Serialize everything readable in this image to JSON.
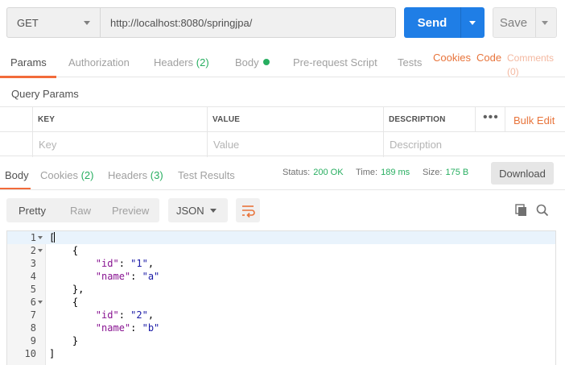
{
  "request": {
    "method": "GET",
    "url": "http://localhost:8080/springjpa/",
    "send_label": "Send",
    "save_label": "Save"
  },
  "request_tabs": [
    {
      "label": "Params"
    },
    {
      "label": "Authorization"
    },
    {
      "label": "Headers",
      "count": "(2)"
    },
    {
      "label": "Body"
    },
    {
      "label": "Pre-request Script"
    },
    {
      "label": "Tests"
    }
  ],
  "links": {
    "cookies": "Cookies",
    "code": "Code",
    "comments": "Comments",
    "comments_count": "(0)"
  },
  "query_params": {
    "title": "Query Params",
    "headers": [
      "KEY",
      "VALUE",
      "DESCRIPTION"
    ],
    "placeholders": [
      "Key",
      "Value",
      "Description"
    ],
    "more": "•••",
    "bulk_edit": "Bulk Edit"
  },
  "response_tabs": [
    {
      "label": "Body"
    },
    {
      "label": "Cookies",
      "count": "(2)"
    },
    {
      "label": "Headers",
      "count": "(3)"
    },
    {
      "label": "Test Results"
    }
  ],
  "status": {
    "status_label": "Status:",
    "status_value": "200 OK",
    "time_label": "Time:",
    "time_value": "189 ms",
    "size_label": "Size:",
    "size_value": "175 B",
    "download_label": "Download"
  },
  "view": {
    "modes": [
      "Pretty",
      "Raw",
      "Preview"
    ],
    "format": "JSON"
  },
  "icons": {
    "wrap": "wrap-lines-icon",
    "copy": "copy-icon",
    "search": "search-icon"
  },
  "colors": {
    "accent": "#f26b3a",
    "primary": "#1f7ee6",
    "success": "#27ae60",
    "json_key": "#881391",
    "json_string": "#1a1aa6"
  },
  "code_lines": [
    {
      "n": "1",
      "text": "["
    },
    {
      "n": "2",
      "text": "    {"
    },
    {
      "n": "3",
      "key": "\"id\"",
      "value": "\"1\"",
      "trail": ","
    },
    {
      "n": "4",
      "key": "\"name\"",
      "value": "\"a\"",
      "trail": ""
    },
    {
      "n": "5",
      "text": "    },"
    },
    {
      "n": "6",
      "text": "    {"
    },
    {
      "n": "7",
      "key": "\"id\"",
      "value": "\"2\"",
      "trail": ","
    },
    {
      "n": "8",
      "key": "\"name\"",
      "value": "\"b\"",
      "trail": ""
    },
    {
      "n": "9",
      "text": "    }"
    },
    {
      "n": "10",
      "text": "]"
    }
  ]
}
